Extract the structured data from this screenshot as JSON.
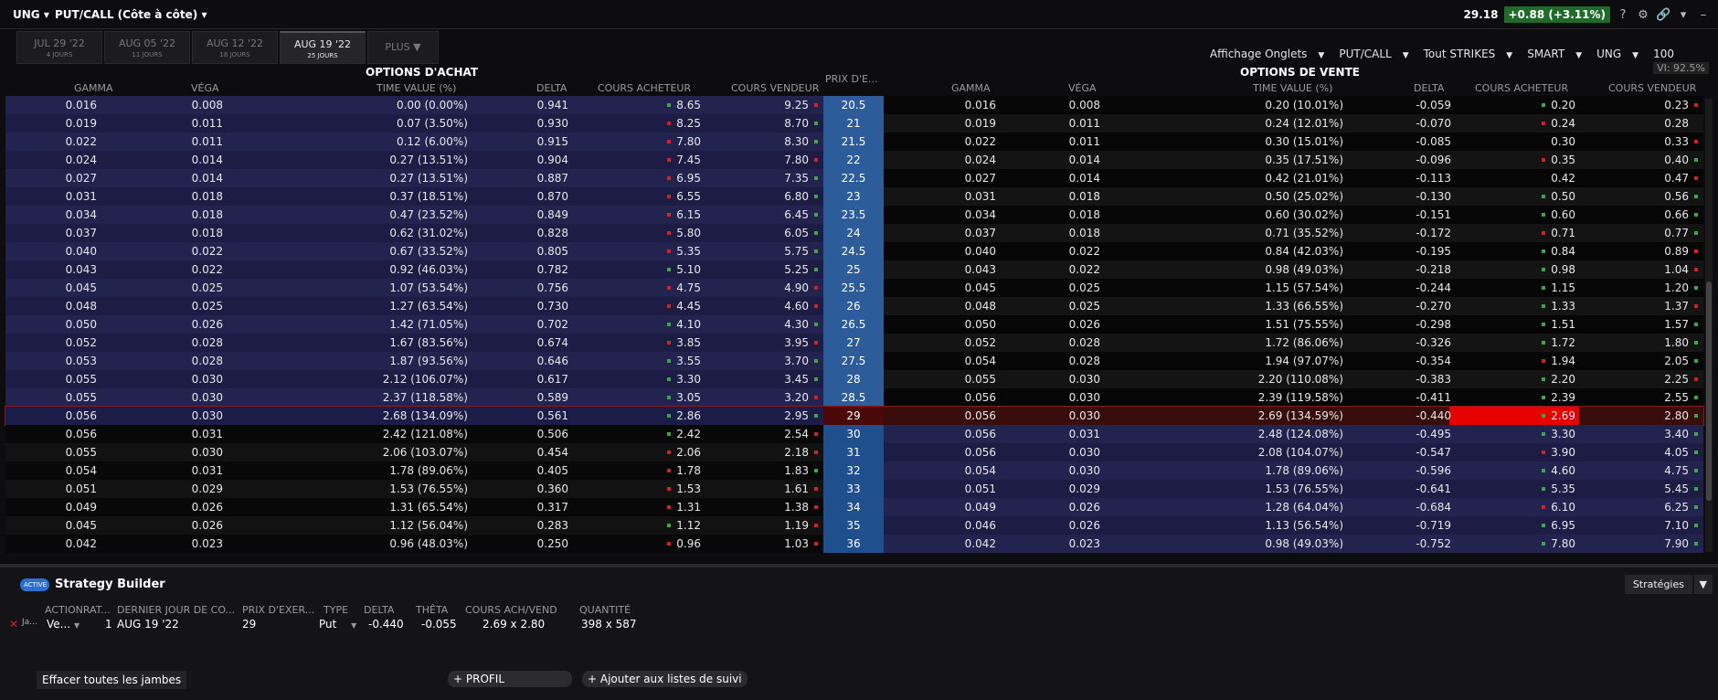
{
  "topbar": {
    "symbol": "UNG",
    "mode": "PUT/CALL (Côte à côte)",
    "price": "29.18",
    "change": "+0.88 (+3.11%)",
    "icons": [
      "help-icon",
      "gear-icon",
      "link-icon",
      "chevron-down-icon",
      "minimize-icon"
    ]
  },
  "tabs": [
    {
      "label": "JUL 29 '22",
      "sub": "4 JOURS"
    },
    {
      "label": "AUG 05 '22",
      "sub": "11 JOURS"
    },
    {
      "label": "AUG 12 '22",
      "sub": "18 JOURS"
    },
    {
      "label": "AUG 19 '22",
      "sub": "25 JOURS"
    },
    {
      "label": "PLUS ▼"
    }
  ],
  "controls": [
    "Affichage Onglets",
    "PUT/CALL",
    "Tout STRIKES",
    "SMART",
    "UNG",
    "100"
  ],
  "vi_label": "VI: 92.5%",
  "headers": {
    "calls_title": "OPTIONS D'ACHAT",
    "puts_title": "OPTIONS DE VENTE",
    "gamma": "GAMMA",
    "vega": "VÉGA",
    "time_value": "TIME VALUE (%)",
    "delta": "DELTA",
    "bid": "COURS ACHETEUR",
    "ask": "COURS VENDEUR",
    "strike": "PRIX D'E..."
  },
  "rows": [
    {
      "strike": "20.5",
      "c": [
        "0.016",
        "0.008",
        "0.00 (0.00%)",
        "0.941",
        "8.65",
        "9.25"
      ],
      "cb": "g",
      "ca": "r",
      "p": [
        "0.016",
        "0.008",
        "0.20 (10.01%)",
        "-0.059",
        "0.20",
        "0.23"
      ],
      "pb": "g",
      "pa": "r"
    },
    {
      "strike": "21",
      "c": [
        "0.019",
        "0.011",
        "0.07 (3.50%)",
        "0.930",
        "8.25",
        "8.70"
      ],
      "cb": "r",
      "ca": "g",
      "p": [
        "0.019",
        "0.011",
        "0.24 (12.01%)",
        "-0.070",
        "0.24",
        "0.28"
      ],
      "pb": "r",
      "pa": ""
    },
    {
      "strike": "21.5",
      "c": [
        "0.022",
        "0.011",
        "0.12 (6.00%)",
        "0.915",
        "7.80",
        "8.30"
      ],
      "cb": "r",
      "ca": "g",
      "p": [
        "0.022",
        "0.011",
        "0.30 (15.01%)",
        "-0.085",
        "0.30",
        "0.33"
      ],
      "pb": "",
      "pa": "r"
    },
    {
      "strike": "22",
      "c": [
        "0.024",
        "0.014",
        "0.27 (13.51%)",
        "0.904",
        "7.45",
        "7.80"
      ],
      "cb": "r",
      "ca": "r",
      "p": [
        "0.024",
        "0.014",
        "0.35 (17.51%)",
        "-0.096",
        "0.35",
        "0.40"
      ],
      "pb": "r",
      "pa": "g"
    },
    {
      "strike": "22.5",
      "c": [
        "0.027",
        "0.014",
        "0.27 (13.51%)",
        "0.887",
        "6.95",
        "7.35"
      ],
      "cb": "r",
      "ca": "g",
      "p": [
        "0.027",
        "0.014",
        "0.42 (21.01%)",
        "-0.113",
        "0.42",
        "0.47"
      ],
      "pb": "",
      "pa": "r"
    },
    {
      "strike": "23",
      "c": [
        "0.031",
        "0.018",
        "0.37 (18.51%)",
        "0.870",
        "6.55",
        "6.80"
      ],
      "cb": "r",
      "ca": "g",
      "p": [
        "0.031",
        "0.018",
        "0.50 (25.02%)",
        "-0.130",
        "0.50",
        "0.56"
      ],
      "pb": "g",
      "pa": "g"
    },
    {
      "strike": "23.5",
      "c": [
        "0.034",
        "0.018",
        "0.47 (23.52%)",
        "0.849",
        "6.15",
        "6.45"
      ],
      "cb": "r",
      "ca": "g",
      "p": [
        "0.034",
        "0.018",
        "0.60 (30.02%)",
        "-0.151",
        "0.60",
        "0.66"
      ],
      "pb": "g",
      "pa": "g"
    },
    {
      "strike": "24",
      "c": [
        "0.037",
        "0.018",
        "0.62 (31.02%)",
        "0.828",
        "5.80",
        "6.05"
      ],
      "cb": "r",
      "ca": "g",
      "p": [
        "0.037",
        "0.018",
        "0.71 (35.52%)",
        "-0.172",
        "0.71",
        "0.77"
      ],
      "pb": "r",
      "pa": "g"
    },
    {
      "strike": "24.5",
      "c": [
        "0.040",
        "0.022",
        "0.67 (33.52%)",
        "0.805",
        "5.35",
        "5.75"
      ],
      "cb": "r",
      "ca": "g",
      "p": [
        "0.040",
        "0.022",
        "0.84 (42.03%)",
        "-0.195",
        "0.84",
        "0.89"
      ],
      "pb": "g",
      "pa": "r"
    },
    {
      "strike": "25",
      "c": [
        "0.043",
        "0.022",
        "0.92 (46.03%)",
        "0.782",
        "5.10",
        "5.25"
      ],
      "cb": "g",
      "ca": "g",
      "p": [
        "0.043",
        "0.022",
        "0.98 (49.03%)",
        "-0.218",
        "0.98",
        "1.04"
      ],
      "pb": "g",
      "pa": "r"
    },
    {
      "strike": "25.5",
      "c": [
        "0.045",
        "0.025",
        "1.07 (53.54%)",
        "0.756",
        "4.75",
        "4.90"
      ],
      "cb": "r",
      "ca": "r",
      "p": [
        "0.045",
        "0.025",
        "1.15 (57.54%)",
        "-0.244",
        "1.15",
        "1.20"
      ],
      "pb": "g",
      "pa": "g"
    },
    {
      "strike": "26",
      "c": [
        "0.048",
        "0.025",
        "1.27 (63.54%)",
        "0.730",
        "4.45",
        "4.60"
      ],
      "cb": "r",
      "ca": "r",
      "p": [
        "0.048",
        "0.025",
        "1.33 (66.55%)",
        "-0.270",
        "1.33",
        "1.37"
      ],
      "pb": "g",
      "pa": "r"
    },
    {
      "strike": "26.5",
      "c": [
        "0.050",
        "0.026",
        "1.42 (71.05%)",
        "0.702",
        "4.10",
        "4.30"
      ],
      "cb": "g",
      "ca": "g",
      "p": [
        "0.050",
        "0.026",
        "1.51 (75.55%)",
        "-0.298",
        "1.51",
        "1.57"
      ],
      "pb": "g",
      "pa": "g"
    },
    {
      "strike": "27",
      "c": [
        "0.052",
        "0.028",
        "1.67 (83.56%)",
        "0.674",
        "3.85",
        "3.95"
      ],
      "cb": "r",
      "ca": "r",
      "p": [
        "0.052",
        "0.028",
        "1.72 (86.06%)",
        "-0.326",
        "1.72",
        "1.80"
      ],
      "pb": "g",
      "pa": "g"
    },
    {
      "strike": "27.5",
      "c": [
        "0.053",
        "0.028",
        "1.87 (93.56%)",
        "0.646",
        "3.55",
        "3.70"
      ],
      "cb": "g",
      "ca": "g",
      "p": [
        "0.054",
        "0.028",
        "1.94 (97.07%)",
        "-0.354",
        "1.94",
        "2.05"
      ],
      "pb": "r",
      "pa": "g"
    },
    {
      "strike": "28",
      "c": [
        "0.055",
        "0.030",
        "2.12 (106.07%)",
        "0.617",
        "3.30",
        "3.45"
      ],
      "cb": "g",
      "ca": "g",
      "p": [
        "0.055",
        "0.030",
        "2.20 (110.08%)",
        "-0.383",
        "2.20",
        "2.25"
      ],
      "pb": "g",
      "pa": "r"
    },
    {
      "strike": "28.5",
      "c": [
        "0.055",
        "0.030",
        "2.37 (118.58%)",
        "0.589",
        "3.05",
        "3.20"
      ],
      "cb": "g",
      "ca": "r",
      "p": [
        "0.056",
        "0.030",
        "2.39 (119.58%)",
        "-0.411",
        "2.39",
        "2.55"
      ],
      "pb": "g",
      "pa": "g"
    },
    {
      "strike": "29",
      "c": [
        "0.056",
        "0.030",
        "2.68 (134.09%)",
        "0.561",
        "2.86",
        "2.95"
      ],
      "cb": "g",
      "ca": "g",
      "p": [
        "0.056",
        "0.030",
        "2.69 (134.59%)",
        "-0.440",
        "2.69",
        "2.80"
      ],
      "pb": "g",
      "pa": "g",
      "selected": true
    },
    {
      "strike": "30",
      "c": [
        "0.056",
        "0.031",
        "2.42 (121.08%)",
        "0.506",
        "2.42",
        "2.54"
      ],
      "cb": "g",
      "ca": "r",
      "p": [
        "0.056",
        "0.031",
        "2.48 (124.08%)",
        "-0.495",
        "3.30",
        "3.40"
      ],
      "pb": "g",
      "pa": "g"
    },
    {
      "strike": "31",
      "c": [
        "0.055",
        "0.030",
        "2.06 (103.07%)",
        "0.454",
        "2.06",
        "2.18"
      ],
      "cb": "r",
      "ca": "r",
      "p": [
        "0.056",
        "0.030",
        "2.08 (104.07%)",
        "-0.547",
        "3.90",
        "4.05"
      ],
      "pb": "r",
      "pa": "g"
    },
    {
      "strike": "32",
      "c": [
        "0.054",
        "0.031",
        "1.78 (89.06%)",
        "0.405",
        "1.78",
        "1.83"
      ],
      "cb": "r",
      "ca": "g",
      "p": [
        "0.054",
        "0.030",
        "1.78 (89.06%)",
        "-0.596",
        "4.60",
        "4.75"
      ],
      "pb": "g",
      "pa": "g"
    },
    {
      "strike": "33",
      "c": [
        "0.051",
        "0.029",
        "1.53 (76.55%)",
        "0.360",
        "1.53",
        "1.61"
      ],
      "cb": "r",
      "ca": "r",
      "p": [
        "0.051",
        "0.029",
        "1.53 (76.55%)",
        "-0.641",
        "5.35",
        "5.45"
      ],
      "pb": "g",
      "pa": "g"
    },
    {
      "strike": "34",
      "c": [
        "0.049",
        "0.026",
        "1.31 (65.54%)",
        "0.317",
        "1.31",
        "1.38"
      ],
      "cb": "r",
      "ca": "r",
      "p": [
        "0.049",
        "0.026",
        "1.28 (64.04%)",
        "-0.684",
        "6.10",
        "6.25"
      ],
      "pb": "r",
      "pa": "g"
    },
    {
      "strike": "35",
      "c": [
        "0.045",
        "0.026",
        "1.12 (56.04%)",
        "0.283",
        "1.12",
        "1.19"
      ],
      "cb": "g",
      "ca": "r",
      "p": [
        "0.046",
        "0.026",
        "1.13 (56.54%)",
        "-0.719",
        "6.95",
        "7.10"
      ],
      "pb": "g",
      "pa": "g"
    },
    {
      "strike": "36",
      "c": [
        "0.042",
        "0.023",
        "0.96 (48.03%)",
        "0.250",
        "0.96",
        "1.03"
      ],
      "cb": "r",
      "ca": "r",
      "p": [
        "0.042",
        "0.023",
        "0.98 (49.03%)",
        "-0.752",
        "7.80",
        "7.90"
      ],
      "pb": "g",
      "pa": "g"
    }
  ],
  "strategy_builder": {
    "toggle_label": "ACTIVE",
    "title": "Strategy Builder",
    "strategies_btn": "Stratégies",
    "headers": [
      "ACTIONRAT...",
      "DERNIER JOUR DE CO...",
      "PRIX D'EXER...",
      "TYPE",
      "DELTA",
      "THÊTA",
      "COURS ACH/VEND",
      "QUANTITÉ"
    ],
    "leg": {
      "side_prefix": "Ja...",
      "action": "Ve...",
      "ratio": "1",
      "last_day": "AUG 19 '22",
      "strike": "29",
      "type": "Put",
      "delta": "-0.440",
      "theta": "-0.055",
      "bid_ask": "2.69 x 2.80",
      "quantity": "398 x 587"
    },
    "clear_btn": "Effacer toutes les jambes",
    "profile_btn": "+ PROFIL",
    "watchlist_btn": "+ Ajouter aux listes de suivi"
  }
}
